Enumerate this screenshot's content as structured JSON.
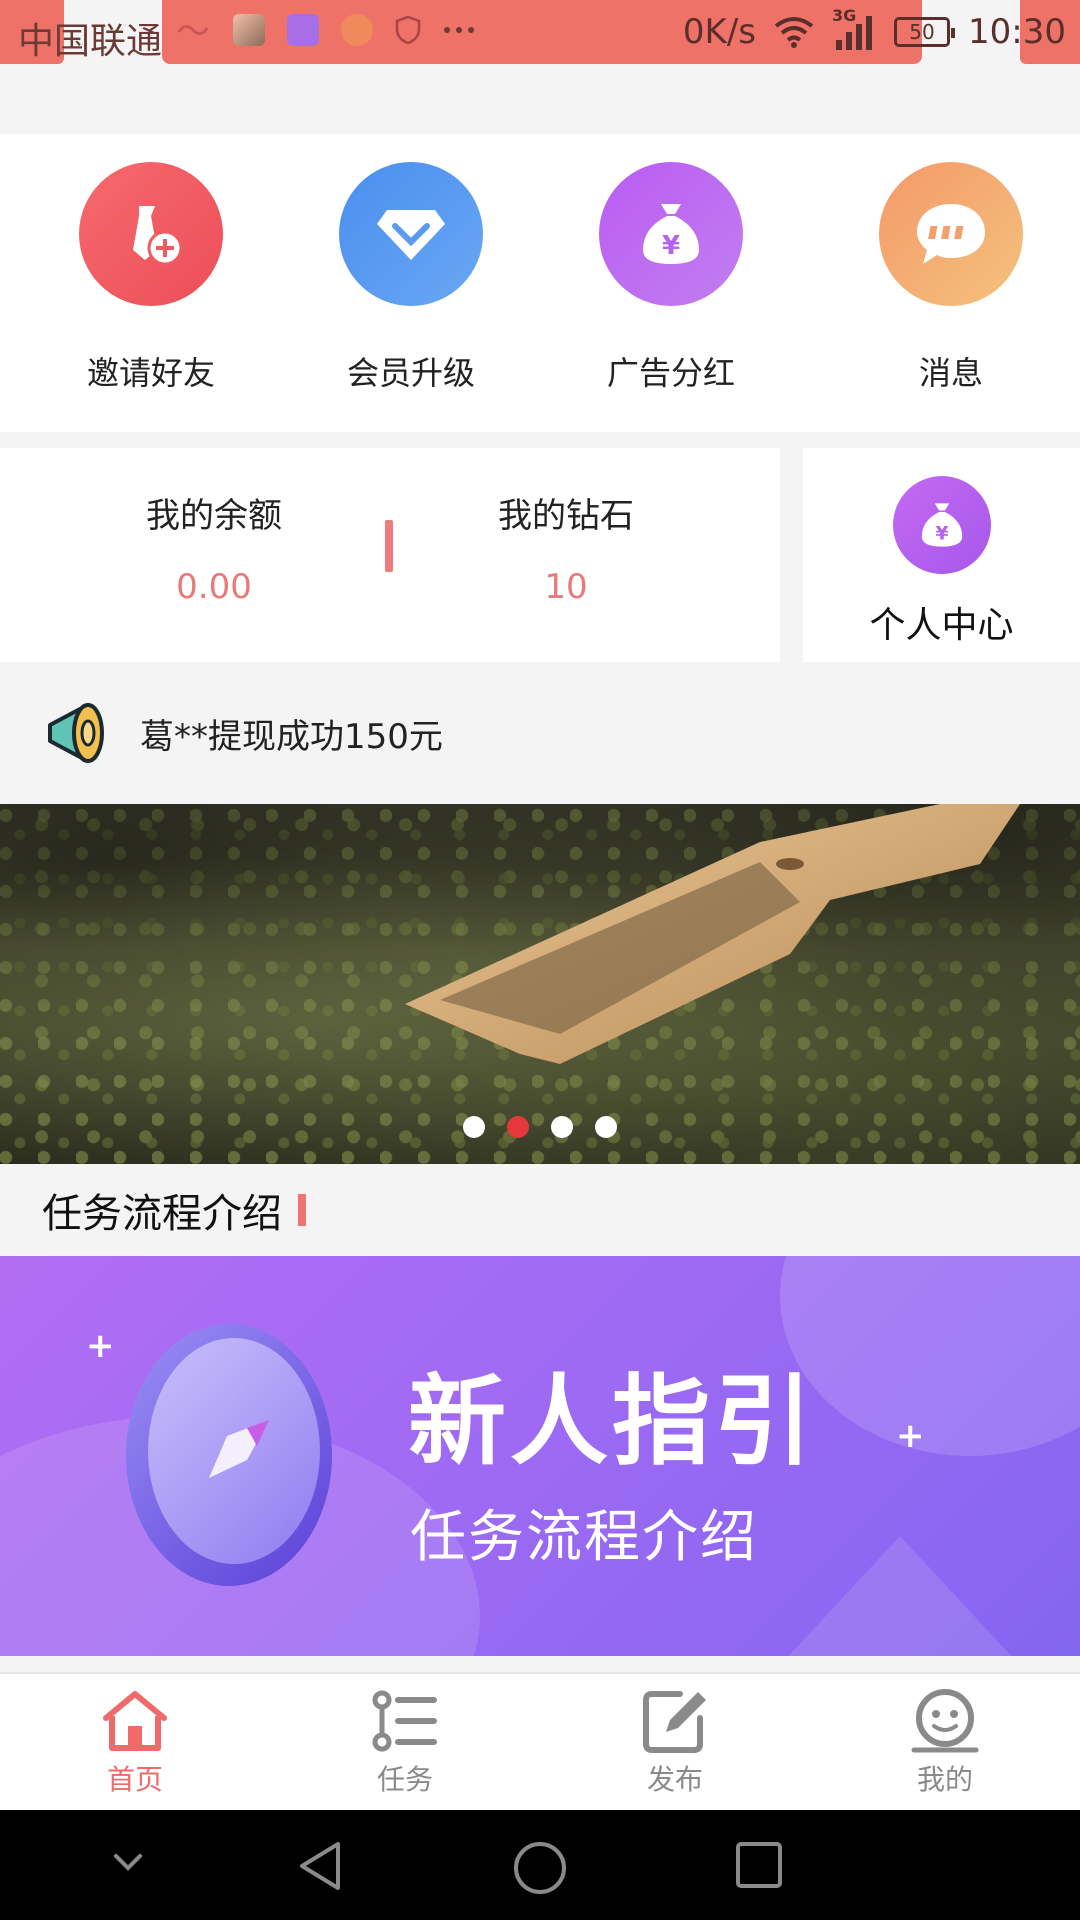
{
  "status_bar": {
    "carrier": "中国联通",
    "network_speed": "0K/s",
    "network_type": "3G",
    "battery": "50",
    "time": "10:30"
  },
  "quick_menu": [
    {
      "label": "邀请好友",
      "icon": "invite-friend-icon",
      "color": "#f15a5f"
    },
    {
      "label": "会员升级",
      "icon": "diamond-icon",
      "color": "#4f95f0"
    },
    {
      "label": "广告分红",
      "icon": "money-bag-icon",
      "color": "#b463f0"
    },
    {
      "label": "消息",
      "icon": "chat-bubble-icon",
      "color": "#f5a76b"
    }
  ],
  "account": {
    "balance_label": "我的余额",
    "balance_value": "0.00",
    "diamond_label": "我的钻石",
    "diamond_value": "10",
    "personal_center_label": "个人中心"
  },
  "notice": {
    "text": "葛**提现成功150元"
  },
  "carousel": {
    "slide_count": 4,
    "active_index": 1
  },
  "section": {
    "title": "任务流程介绍"
  },
  "guide_banner": {
    "title": "新人指引",
    "subtitle": "任务流程介绍"
  },
  "tabbar": [
    {
      "label": "首页",
      "icon": "home-icon",
      "active": true
    },
    {
      "label": "任务",
      "icon": "task-list-icon",
      "active": false
    },
    {
      "label": "发布",
      "icon": "edit-icon",
      "active": false
    },
    {
      "label": "我的",
      "icon": "profile-face-icon",
      "active": false
    }
  ],
  "colors": {
    "accent": "#ef6a6a",
    "status_bar": "#ef7268",
    "active_dot": "#e4393c"
  }
}
